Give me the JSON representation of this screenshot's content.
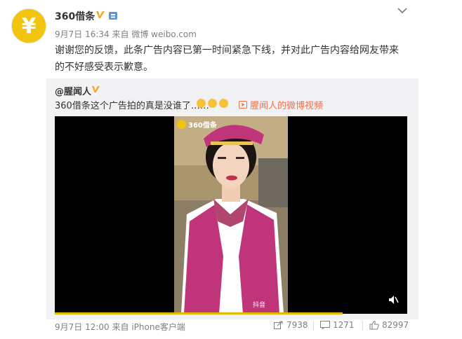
{
  "post": {
    "author": "360借条",
    "avatar_glyph": "¥",
    "time": "9月7日 16:34",
    "source_prefix": "来自",
    "source": "微博 weibo.com",
    "text_line1": "谢谢您的反馈，此条广告内容已第一时间紧急下线，并对此广告内容给网友带来",
    "text_line2": "的不好感受表示歉意。"
  },
  "repost": {
    "author": "@腥闻人",
    "text": "360借条这个广告拍的真是没谁了……",
    "video_link": "腥闻人的微博视频",
    "video_watermark": "360借条",
    "douyin_mark": "抖音",
    "footer_time": "9月7日 12:00",
    "footer_source": "来自 iPhone客户端",
    "reposts": "7938",
    "comments": "1271",
    "likes": "82997"
  },
  "colors": {
    "link": "#eb7350",
    "meta": "#808080",
    "repost_bg": "#f2f2f5",
    "verified": "#f5a623"
  }
}
